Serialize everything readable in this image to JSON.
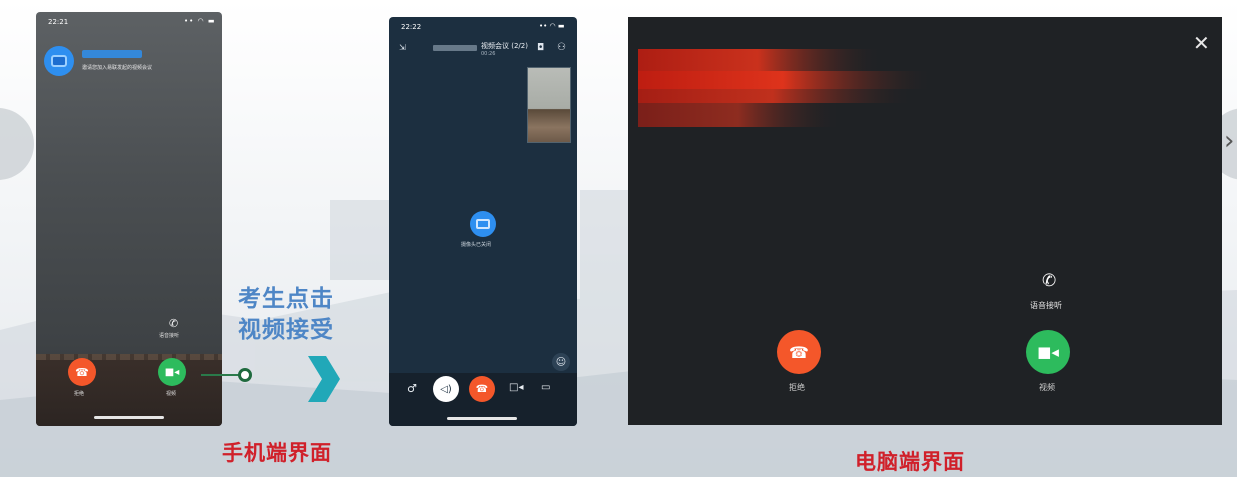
{
  "phone": {
    "time": "22:21",
    "status_icons": "•• ◠ ▬",
    "subtitle": "邀请您加入易联发起的视频会议",
    "voice_icon": "phone-voice-icon",
    "voice_label": "语音接听",
    "decline_glyph": "☎",
    "accept_glyph": "■◂",
    "decline_label": "拒绝",
    "accept_label": "视频"
  },
  "instruction": {
    "line1": "考生点击",
    "line2": "视频接受"
  },
  "phone_call": {
    "time": "22:22",
    "status_icons": "•• ◠ ▬",
    "shrink_glyph": "⇲",
    "title": "视频会议 (2/2)",
    "duration": "00:26",
    "camera_glyph": "◘",
    "members_glyph": "⚇",
    "center_label": "摄像头已关闭",
    "emoji_glyph": "☺",
    "mic_glyph": "♂",
    "speaker_glyph": "◁)",
    "hangup_glyph": "☎",
    "video_glyph": "□◂",
    "screen_glyph": "▭"
  },
  "desktop": {
    "close_glyph": "✕",
    "voice_glyph": "✆",
    "voice_label": "语音接听",
    "decline_glyph": "☎",
    "accept_glyph": "■◂",
    "decline_label": "拒绝",
    "accept_label": "视频"
  },
  "captions": {
    "phone": "手机端界面",
    "desktop": "电脑端界面"
  },
  "nav": {
    "next_glyph": "›"
  },
  "colors": {
    "decline": "#f4572a",
    "accept": "#2dbb5d",
    "caption": "#d0202a",
    "instruction": "#4e86c6",
    "arrow": "#21a8b8"
  }
}
